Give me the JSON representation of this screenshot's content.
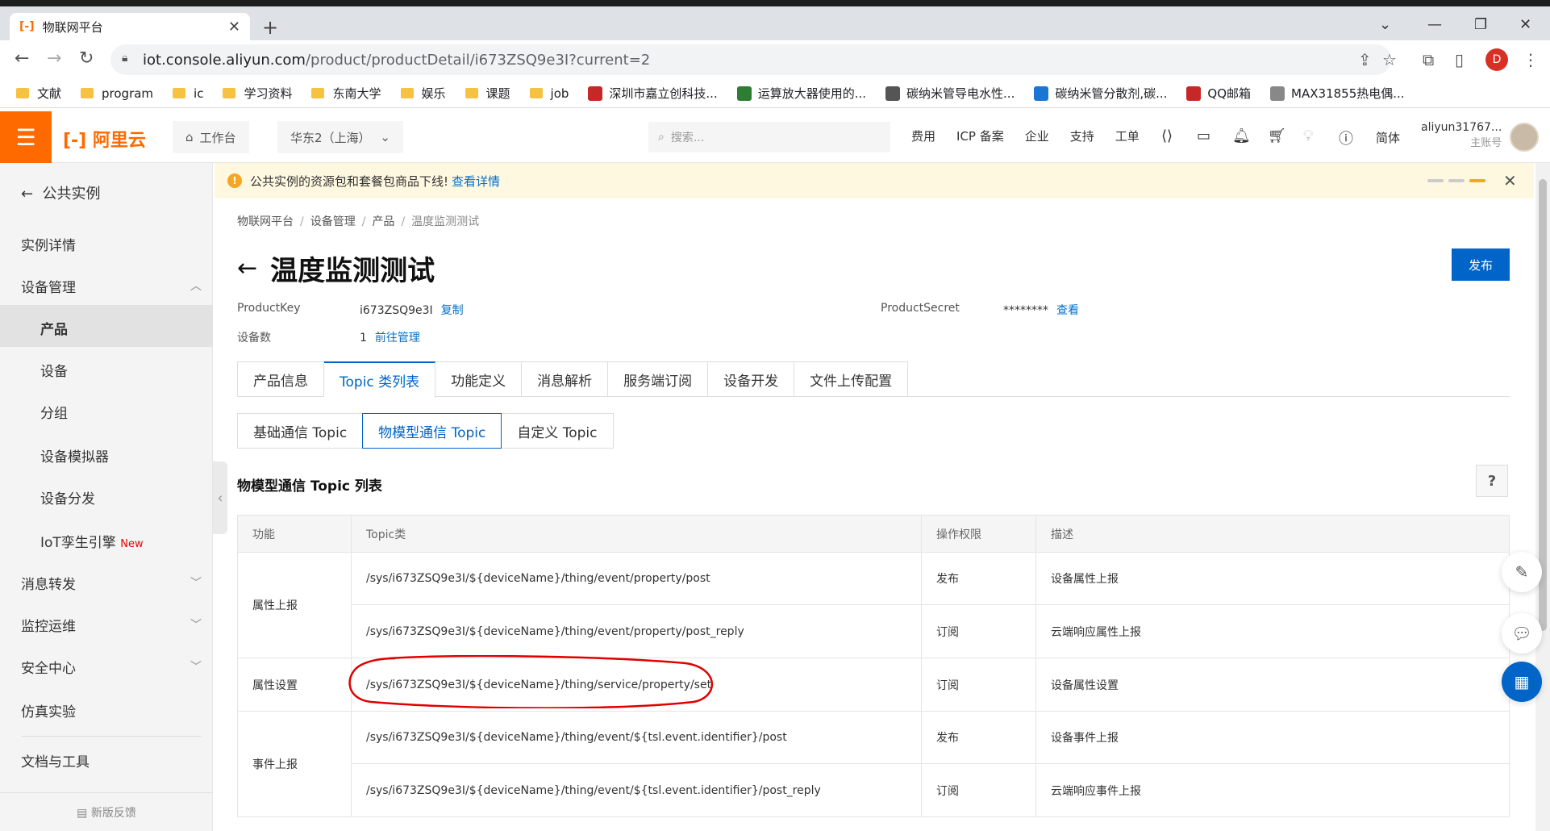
{
  "browser": {
    "tab_title": "物联网平台",
    "url_domain": "iot.console.aliyun.com",
    "url_path": "/product/productDetail/i673ZSQ9e3I?current=2",
    "profile_initial": "D",
    "bookmarks": [
      "文献",
      "program",
      "ic",
      "学习资料",
      "东南大学",
      "娱乐",
      "课题",
      "job",
      "深圳市嘉立创科技...",
      "运算放大器使用的...",
      "碳纳米管导电水性...",
      "碳纳米管分散剂,碳...",
      "QQ邮箱",
      "MAX31855热电偶..."
    ]
  },
  "topnav": {
    "logo": "阿里云",
    "workspace": "工作台",
    "region": "华东2（上海）",
    "search_placeholder": "搜索...",
    "links": [
      "费用",
      "ICP 备案",
      "企业",
      "支持",
      "工单"
    ],
    "lang": "简体",
    "username": "aliyun31767...",
    "account_type": "主账号"
  },
  "sidebar": {
    "back": "公共实例",
    "instance_detail": "实例详情",
    "device_mgmt": "设备管理",
    "sub_items": [
      "产品",
      "设备",
      "分组",
      "设备模拟器",
      "设备分发"
    ],
    "iot_twin": "IoT孪生引擎",
    "new_badge": "New",
    "msg_forward": "消息转发",
    "monitor": "监控运维",
    "security": "安全中心",
    "sim": "仿真实验",
    "docs": "文档与工具",
    "feedback": "新版反馈"
  },
  "notice": {
    "text": "公共实例的资源包和套餐包商品下线!",
    "link": "查看详情"
  },
  "breadcrumb": [
    "物联网平台",
    "设备管理",
    "产品",
    "温度监测测试"
  ],
  "page": {
    "title": "温度监测测试",
    "publish": "发布",
    "product_key_label": "ProductKey",
    "product_key": "i673ZSQ9e3I",
    "copy": "复制",
    "product_secret_label": "ProductSecret",
    "product_secret": "********",
    "view": "查看",
    "device_count_label": "设备数",
    "device_count": "1",
    "goto_manage": "前往管理"
  },
  "tabs": [
    "产品信息",
    "Topic 类列表",
    "功能定义",
    "消息解析",
    "服务端订阅",
    "设备开发",
    "文件上传配置"
  ],
  "subtabs": [
    "基础通信 Topic",
    "物模型通信 Topic",
    "自定义 Topic"
  ],
  "section_title": "物模型通信 Topic 列表",
  "table": {
    "headers": [
      "功能",
      "Topic类",
      "操作权限",
      "描述"
    ],
    "groups": [
      {
        "label": "属性上报",
        "rows": [
          {
            "topic": "/sys/i673ZSQ9e3I/${deviceName}/thing/event/property/post",
            "perm": "发布",
            "desc": "设备属性上报"
          },
          {
            "topic": "/sys/i673ZSQ9e3I/${deviceName}/thing/event/property/post_reply",
            "perm": "订阅",
            "desc": "云端响应属性上报"
          }
        ]
      },
      {
        "label": "属性设置",
        "rows": [
          {
            "topic": "/sys/i673ZSQ9e3I/${deviceName}/thing/service/property/set",
            "perm": "订阅",
            "desc": "设备属性设置"
          }
        ]
      },
      {
        "label": "事件上报",
        "rows": [
          {
            "topic": "/sys/i673ZSQ9e3I/${deviceName}/thing/event/${tsl.event.identifier}/post",
            "perm": "发布",
            "desc": "设备事件上报"
          },
          {
            "topic": "/sys/i673ZSQ9e3I/${deviceName}/thing/event/${tsl.event.identifier}/post_reply",
            "perm": "订阅",
            "desc": "云端响应事件上报"
          }
        ]
      }
    ]
  },
  "colors": {
    "accent": "#0064c8",
    "brand": "#ff6a00",
    "annotation": "#e00000"
  }
}
